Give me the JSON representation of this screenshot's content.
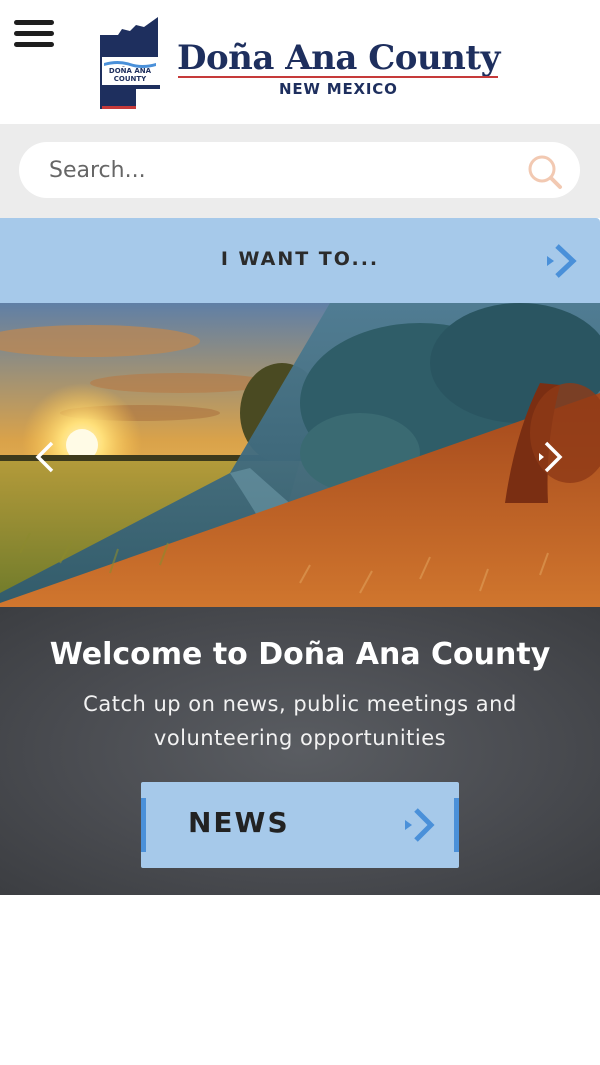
{
  "header": {
    "logo_title": "Doña Ana County",
    "logo_subtitle": "NEW MEXICO",
    "logo_mark_text_1": "DOÑA ANA",
    "logo_mark_text_2": "COUNTY",
    "menu_icon": "hamburger-menu-icon"
  },
  "search": {
    "placeholder": "Search...",
    "icon": "search-icon"
  },
  "i_want_to": {
    "label": "I WANT TO...",
    "icon": "chevron-right-icon"
  },
  "hero": {
    "prev_icon": "chevron-left-icon",
    "next_icon": "chevron-right-icon"
  },
  "welcome": {
    "title": "Welcome to Doña Ana County",
    "text": "Catch up on news, public meetings and volunteering opportunities",
    "button_label": "NEWS"
  },
  "colors": {
    "brand_navy": "#1e2f5e",
    "brand_red": "#c63a3a",
    "light_blue": "#a6c9ea",
    "accent_blue": "#4a90d9",
    "search_icon": "#f2c9b2"
  }
}
